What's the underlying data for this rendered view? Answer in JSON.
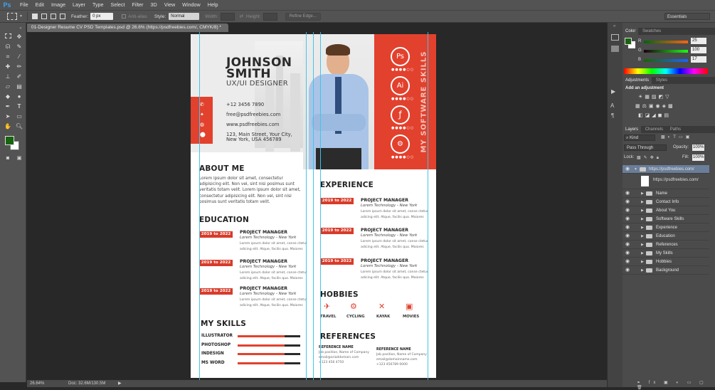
{
  "app": {
    "logo": "Ps"
  },
  "menu": [
    "File",
    "Edit",
    "Image",
    "Layer",
    "Type",
    "Select",
    "Filter",
    "3D",
    "View",
    "Window",
    "Help"
  ],
  "options": {
    "feather_label": "Feather:",
    "feather_value": "0 px",
    "antialias_label": "Anti-alias",
    "style_label": "Style:",
    "style_value": "Normal",
    "width_label": "Width:",
    "height_label": "Height:",
    "refine_label": "Refine Edge...",
    "workspace": "Essentials"
  },
  "doc_tab": "01-Designer Resume CV PSD Templates.psd @ 26.6% (https://psdfreebies.com/, CMYK/8) *",
  "status": {
    "zoom": "26.64%",
    "doc": "Doc: 32.6M/130.5M"
  },
  "color_panel": {
    "tabs": [
      "Color",
      "Swatches"
    ],
    "r_label": "R",
    "g_label": "G",
    "b_label": "B",
    "r": "25",
    "g": "100",
    "b": "17",
    "fg_color": "#196411"
  },
  "adjustments_panel": {
    "tabs": [
      "Adjustments",
      "Styles"
    ],
    "title": "Add an adjustment"
  },
  "layers_panel": {
    "tabs": [
      "Layers",
      "Channels",
      "Paths"
    ],
    "kind_label": "Kind",
    "blend_mode": "Pass Through",
    "opacity_label": "Opacity:",
    "opacity": "100%",
    "lock_label": "Lock:",
    "fill_label": "Fill:",
    "fill": "100%",
    "group_name": "https://psdfreebies.com/",
    "layer_thumb_name": "https://psdfreebies.com/",
    "groups": [
      "Name",
      "Contact Info",
      "About You",
      "Software Skills",
      "Experience",
      "Education",
      "References",
      "My Skills",
      "Hobbies",
      "Background"
    ]
  },
  "resume": {
    "first_name": "JOHNSON",
    "last_name": "SMITH",
    "role": "UX/UI DESIGNER",
    "contacts": [
      "+12 3456 7890",
      "free@psdfreebies.com",
      "www.psdfreebies.com",
      "123, Main Street, Your City,",
      "New York, USA 456789"
    ],
    "software_skills_label": "MY SOFTWARE SKILLS",
    "software": [
      "Ps",
      "Ai",
      "ƒ",
      "⚙"
    ],
    "about_title": "ABOUT ME",
    "about_text": "Lorem ipsum dolor sit amet, consectetur adipisicing elit. Non vel, sint nisi posimus sunt veritatis totam velit. Lorem ipsum dolor sit amet, consectetur adipisicing elit. Non vel, sint nisi posimus sunt veritatis totam velit.",
    "education_title": "EDUCATION",
    "education": [
      {
        "date": "2019 to 2022",
        "title": "PROJECT MANAGER",
        "sub": "Lorem Technology - New York",
        "desc": "Lorem ipsum dolor sit amet, conse ctetur adicing elit. Atque, facilis quo. Maiores"
      },
      {
        "date": "2019 to 2022",
        "title": "PROJECT MANAGER",
        "sub": "Lorem Technology - New York",
        "desc": "Lorem ipsum dolor sit amet, conse ctetur adicing elit. Atque, facilis quo. Maiores"
      },
      {
        "date": "2019 to 2022",
        "title": "PROJECT MANAGER",
        "sub": "Lorem Technology - New York",
        "desc": "Lorem ipsum dolor sit amet, conse ctetur adicing elit. Atque, facilis quo. Maiores"
      }
    ],
    "experience_title": "EXPERIENCE",
    "experience": [
      {
        "date": "2019 to 2022",
        "title": "PROJECT MANAGER",
        "sub": "Lorem Technology - New York",
        "desc": "Lorem ipsum dolor sit amet, conse ctetur adicing elit. Atque, facilis quo. Maiores"
      },
      {
        "date": "2019 to 2022",
        "title": "PROJECT MANAGER",
        "sub": "Lorem Technology - New York",
        "desc": "Lorem ipsum dolor sit amet, conse ctetur adicing elit. Atque, facilis quo. Maiores"
      },
      {
        "date": "2019 to 2022",
        "title": "PROJECT MANAGER",
        "sub": "Lorem Technology - New York",
        "desc": "Lorem ipsum dolor sit amet, conse ctetur adicing elit. Atque, facilis quo. Maiores"
      }
    ],
    "skills_title": "MY SKILLS",
    "skills": [
      {
        "name": "ILLUSTRATOR",
        "level": 0.75
      },
      {
        "name": "PHOTOSHOP",
        "level": 0.75
      },
      {
        "name": "INDESIGN",
        "level": 0.75
      },
      {
        "name": "MS WORD",
        "level": 0.75
      }
    ],
    "hobbies_title": "HOBBIES",
    "hobbies": [
      "TRAVEL",
      "CYCLING",
      "KAYAK",
      "MOVIES"
    ],
    "references_title": "REFERENCES",
    "references": [
      {
        "name": "REFERENCE NAME",
        "line1": "Job position, Name of Company",
        "line2": "email@ariaddomain.com",
        "line3": "+123 456 4750"
      },
      {
        "name": "REFERENCE NAME",
        "line1": "Job position, Name of Company",
        "line2": "email@domainname.com",
        "line3": "+123 456789 0000"
      }
    ]
  }
}
